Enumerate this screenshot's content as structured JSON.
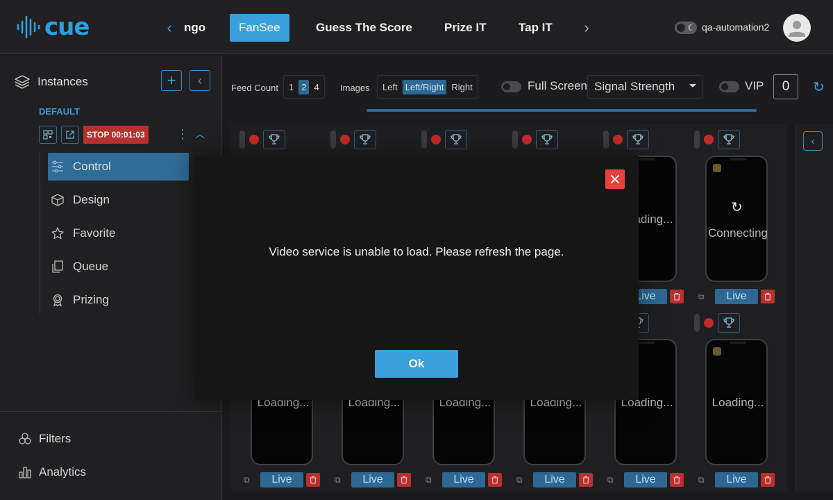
{
  "app": {
    "logo_text": "cue"
  },
  "nav": {
    "tabs": [
      {
        "label": "ngo"
      },
      {
        "label": "FanSee"
      },
      {
        "label": "Guess The Score"
      },
      {
        "label": "Prize IT"
      },
      {
        "label": "Tap IT"
      }
    ],
    "active_tab": "FanSee"
  },
  "user": {
    "name": "qa-automation2",
    "theme": "dark"
  },
  "sidebar": {
    "title": "Instances",
    "group_label": "DEFAULT",
    "instance_status": "STOP 00:01:03",
    "menu": [
      {
        "label": "Control",
        "icon": "sliders-icon"
      },
      {
        "label": "Design",
        "icon": "cube-icon"
      },
      {
        "label": "Favorite",
        "icon": "star-icon"
      },
      {
        "label": "Queue",
        "icon": "queue-icon"
      },
      {
        "label": "Prizing",
        "icon": "award-icon"
      }
    ],
    "active_menu": "Control",
    "bottom": [
      {
        "label": "Filters",
        "icon": "filters-icon"
      },
      {
        "label": "Analytics",
        "icon": "analytics-icon"
      }
    ]
  },
  "toolbar": {
    "feed_count_label": "Feed Count",
    "feed_count_options": [
      "1",
      "2",
      "4"
    ],
    "feed_count_selected": "2",
    "images_label": "Images",
    "images_options": [
      "Left",
      "Left/Right",
      "Right"
    ],
    "images_selected": "Left/Right",
    "full_screen_label": "Full Screen",
    "signal_select": "Signal Strength",
    "vip_label": "VIP",
    "vip_count": "0"
  },
  "feeds": {
    "row1": [
      {
        "status": ""
      },
      {
        "status": ""
      },
      {
        "status": ""
      },
      {
        "status": ""
      },
      {
        "status": "Loading..."
      },
      {
        "status": "Connecting"
      }
    ],
    "row2": [
      {
        "status": "Loading..."
      },
      {
        "status": "Loading..."
      },
      {
        "status": "Loading..."
      },
      {
        "status": "Loading..."
      },
      {
        "status": "Loading..."
      },
      {
        "status": "Loading..."
      }
    ],
    "live_label": "Live"
  },
  "modal": {
    "message": "Video service is unable to load. Please refresh the page.",
    "ok_label": "Ok"
  },
  "colors": {
    "accent": "#3aa0dc",
    "danger": "#e8403a",
    "stop_badge": "#b8302e",
    "background": "#1b1b1d"
  }
}
